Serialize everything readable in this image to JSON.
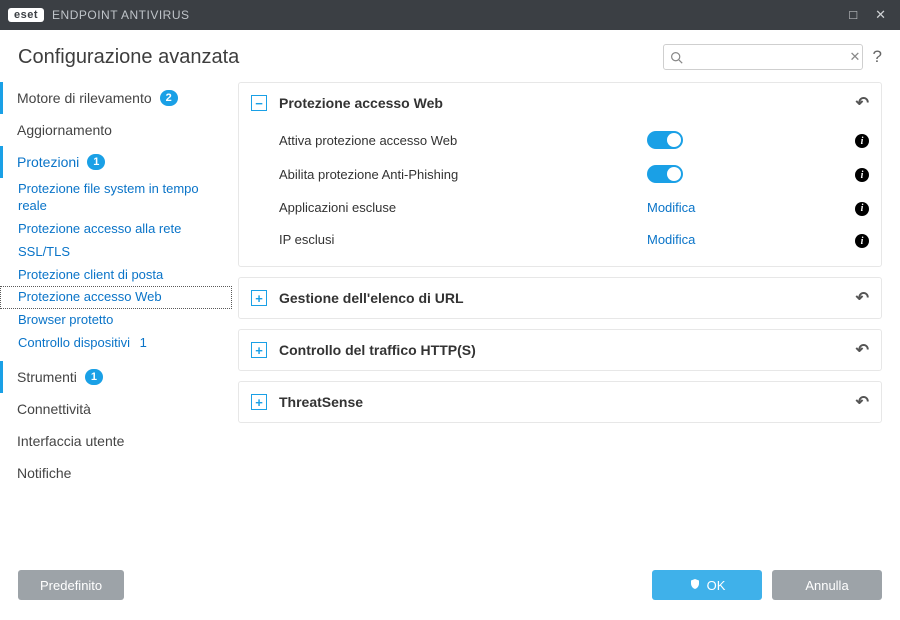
{
  "window": {
    "brand_badge": "eset",
    "brand_title": "ENDPOINT ANTIVIRUS"
  },
  "header": {
    "title": "Configurazione avanzata",
    "search_placeholder": "",
    "help": "?"
  },
  "sidebar": {
    "detection": {
      "label": "Motore di rilevamento",
      "badge": "2"
    },
    "update": {
      "label": "Aggiornamento"
    },
    "protections": {
      "label": "Protezioni",
      "badge": "1"
    },
    "subs": [
      {
        "label": "Protezione file system in tempo reale"
      },
      {
        "label": "Protezione accesso alla rete"
      },
      {
        "label": "SSL/TLS"
      },
      {
        "label": "Protezione client di posta"
      },
      {
        "label": "Protezione accesso Web",
        "selected": true
      },
      {
        "label": "Browser protetto"
      },
      {
        "label": "Controllo dispositivi",
        "badge": "1"
      }
    ],
    "tools": {
      "label": "Strumenti",
      "badge": "1"
    },
    "connectivity": {
      "label": "Connettività"
    },
    "ui": {
      "label": "Interfaccia utente"
    },
    "notif": {
      "label": "Notifiche"
    }
  },
  "panels": {
    "web": {
      "title": "Protezione accesso Web",
      "rows": {
        "enable_web": {
          "label": "Attiva protezione accesso Web",
          "on": true
        },
        "anti_phish": {
          "label": "Abilita protezione Anti-Phishing",
          "on": true
        },
        "apps_excl": {
          "label": "Applicazioni escluse",
          "action": "Modifica"
        },
        "ip_excl": {
          "label": "IP esclusi",
          "action": "Modifica"
        }
      }
    },
    "url_mgmt": {
      "title": "Gestione dell'elenco di URL"
    },
    "https": {
      "title": "Controllo del traffico HTTP(S)"
    },
    "threatsense": {
      "title": "ThreatSense"
    }
  },
  "footer": {
    "default": "Predefinito",
    "ok": "OK",
    "cancel": "Annulla"
  }
}
